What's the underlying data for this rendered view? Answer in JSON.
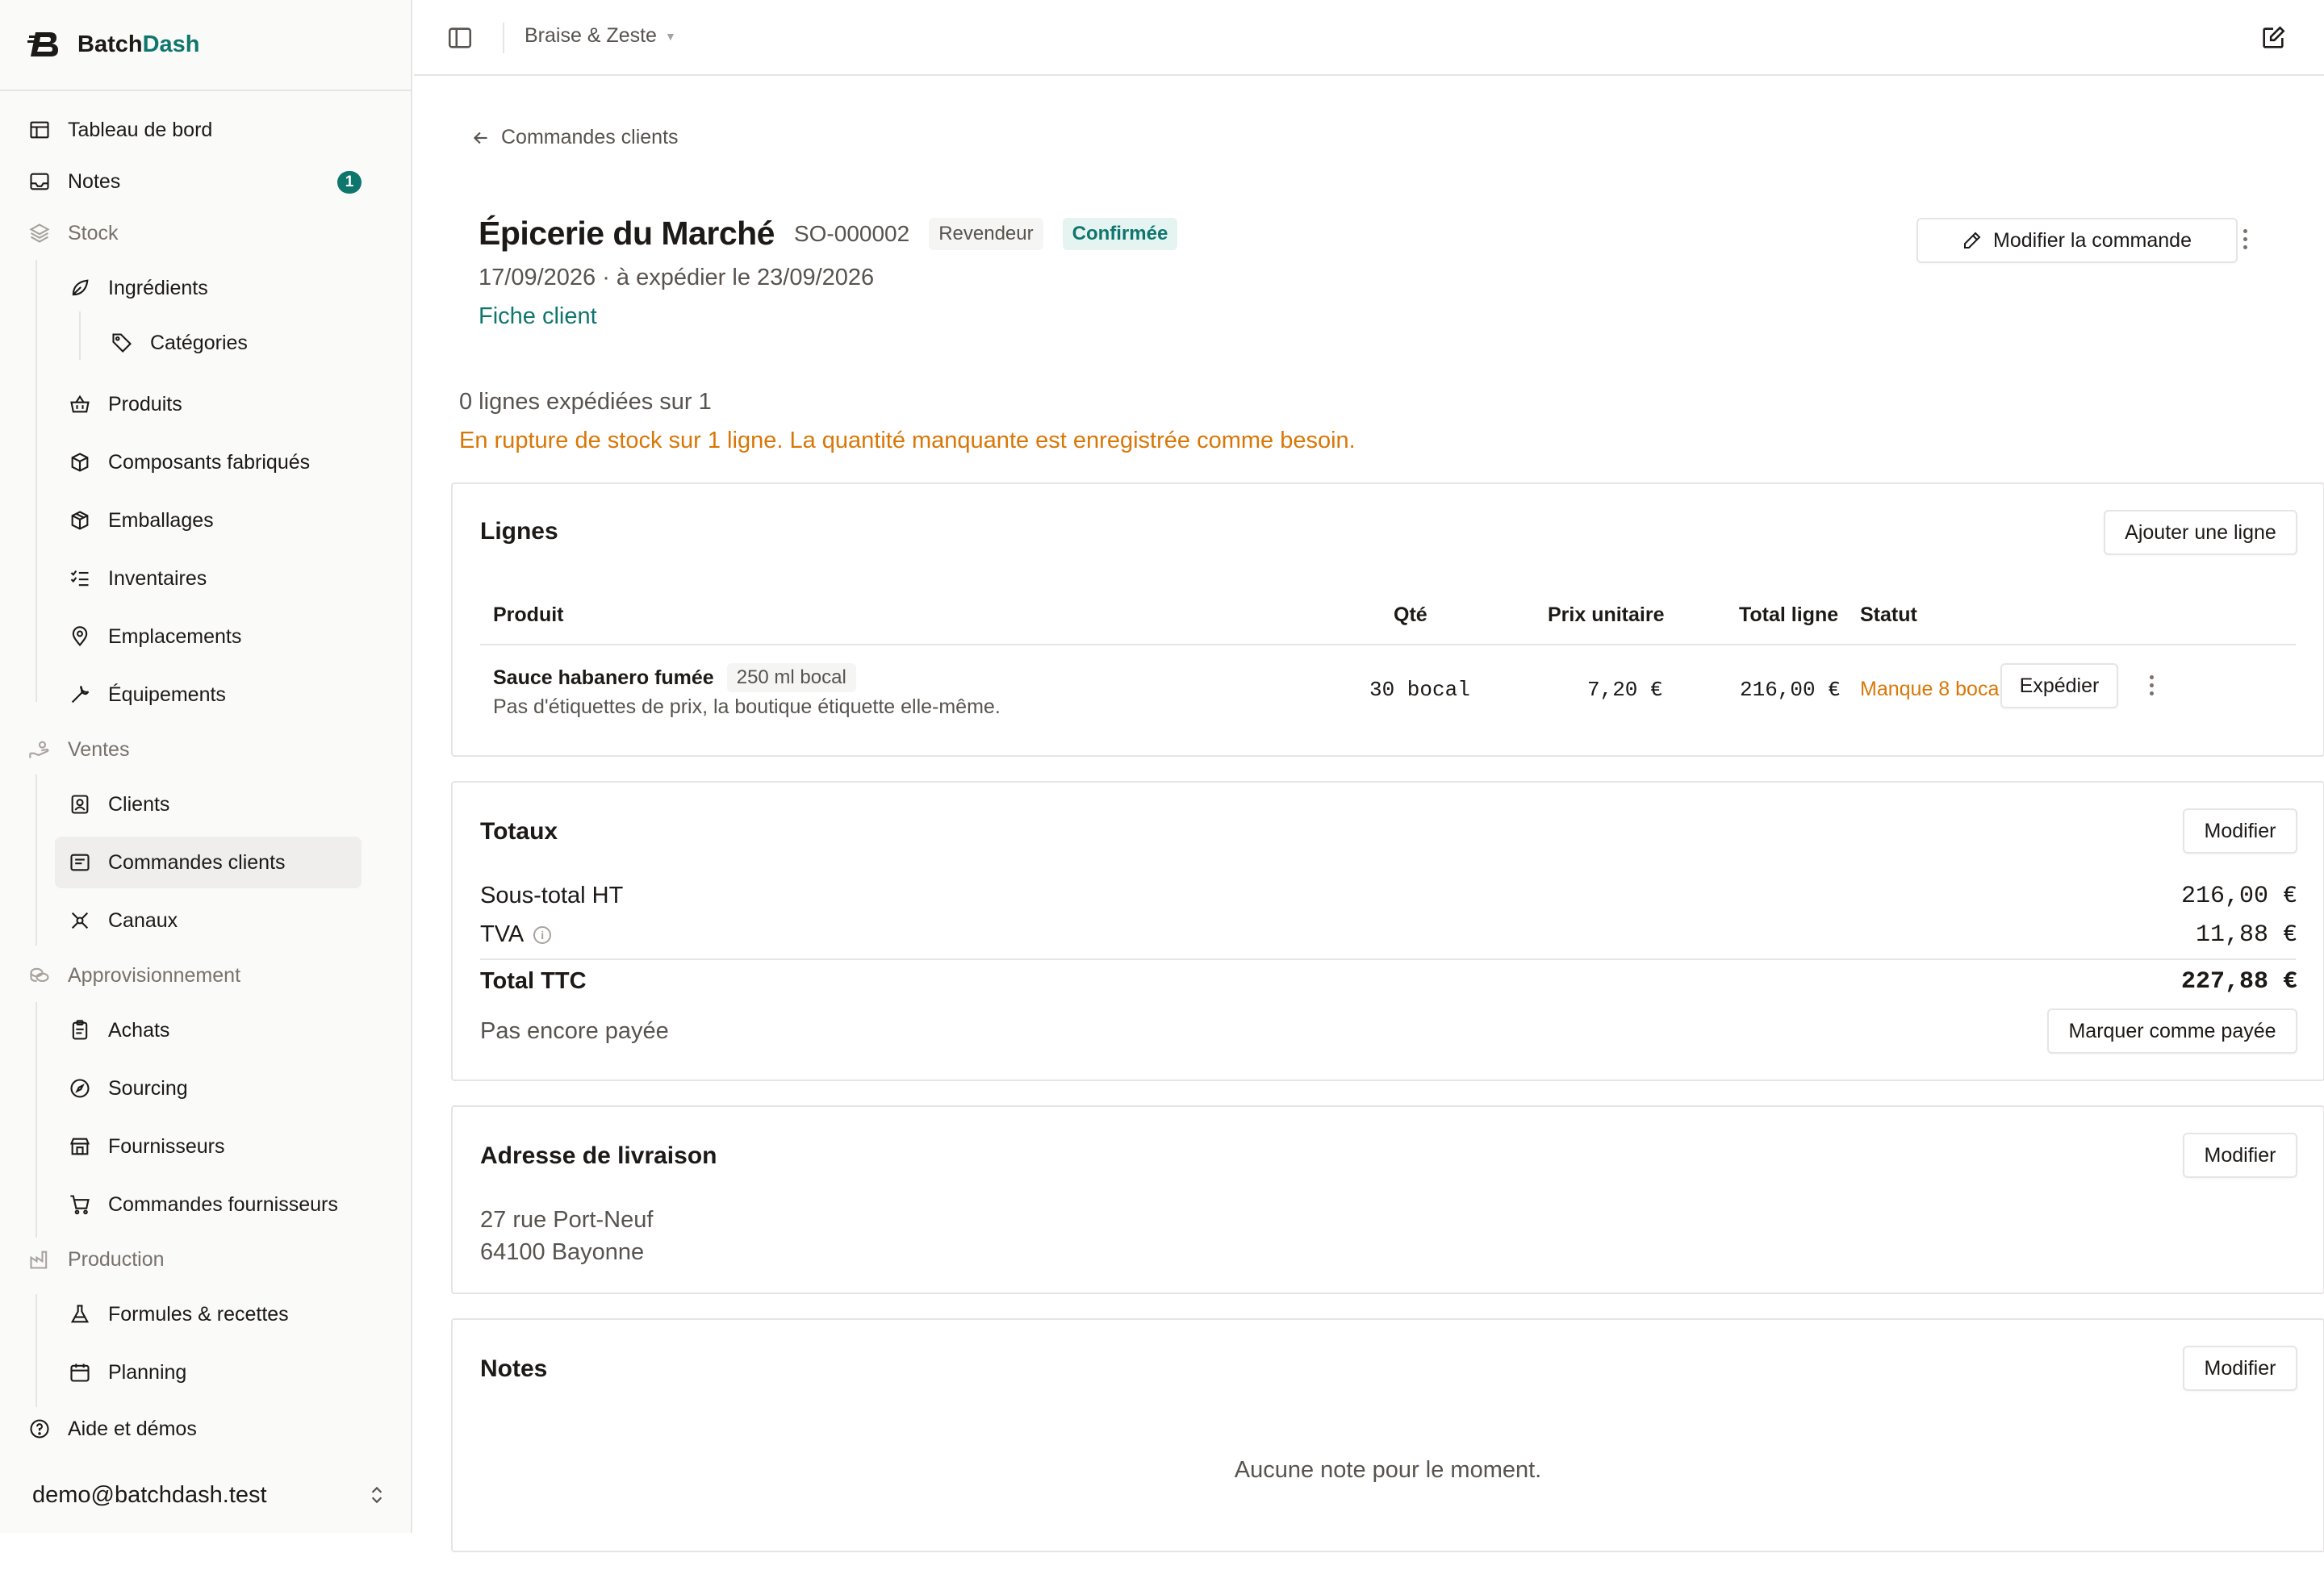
{
  "brand": {
    "name_a": "Batch",
    "name_b": "Dash",
    "accent_color": "#0f766e"
  },
  "sidebar": {
    "dashboard": "Tableau de bord",
    "notes": "Notes",
    "notes_badge": "1",
    "stock": "Stock",
    "ingredients": "Ingrédients",
    "categories": "Catégories",
    "produits": "Produits",
    "composants": "Composants fabriqués",
    "emballages": "Emballages",
    "inventaires": "Inventaires",
    "emplacements": "Emplacements",
    "equipements": "Équipements",
    "ventes": "Ventes",
    "clients": "Clients",
    "commandes_clients": "Commandes clients",
    "canaux": "Canaux",
    "approvisionnement": "Approvisionnement",
    "achats": "Achats",
    "sourcing": "Sourcing",
    "fournisseurs": "Fournisseurs",
    "commandes_fournisseurs": "Commandes fournisseurs",
    "production": "Production",
    "formules": "Formules & recettes",
    "planning": "Planning",
    "aide": "Aide et démos",
    "user_email": "demo@batchdash.test"
  },
  "topbar": {
    "workspace": "Braise & Zeste"
  },
  "order": {
    "back_label": "Commandes clients",
    "customer": "Épicerie du Marché",
    "reference": "SO-000002",
    "type_tag": "Revendeur",
    "status_tag": "Confirmée",
    "dates": "17/09/2026 · à expédier le 23/09/2026",
    "customer_link": "Fiche client",
    "edit_button": "Modifier la commande",
    "shipped_count": "0 lignes expédiées sur 1",
    "stock_warning": "En rupture de stock sur 1 ligne. La quantité manquante est enregistrée comme besoin."
  },
  "lines": {
    "title": "Lignes",
    "add_button": "Ajouter une ligne",
    "headers": {
      "product": "Produit",
      "qty": "Qté",
      "unit_price": "Prix unitaire",
      "total": "Total ligne",
      "status": "Statut"
    },
    "rows": [
      {
        "product": "Sauce habanero fumée",
        "format": "250 ml bocal",
        "note": "Pas d'étiquettes de prix, la boutique étiquette elle-même.",
        "qty": "30 bocal",
        "unit_price": "7,20 €",
        "total": "216,00 €",
        "status": "Manque 8 bocal",
        "action": "Expédier"
      }
    ]
  },
  "totals": {
    "title": "Totaux",
    "edit_button": "Modifier",
    "subtotal_label": "Sous-total HT",
    "subtotal": "216,00 €",
    "tax_label": "TVA",
    "tax": "11,88 €",
    "total_label": "Total TTC",
    "total": "227,88 €",
    "payment_status": "Pas encore payée",
    "pay_button": "Marquer comme payée"
  },
  "shipping": {
    "title": "Adresse de livraison",
    "edit_button": "Modifier",
    "line1": "27 rue Port-Neuf",
    "line2": "64100 Bayonne"
  },
  "notes": {
    "title": "Notes",
    "edit_button": "Modifier",
    "empty": "Aucune note pour le moment."
  },
  "colors": {
    "warning": "#d97706",
    "accent": "#0f766e",
    "text_muted": "#57534e"
  }
}
